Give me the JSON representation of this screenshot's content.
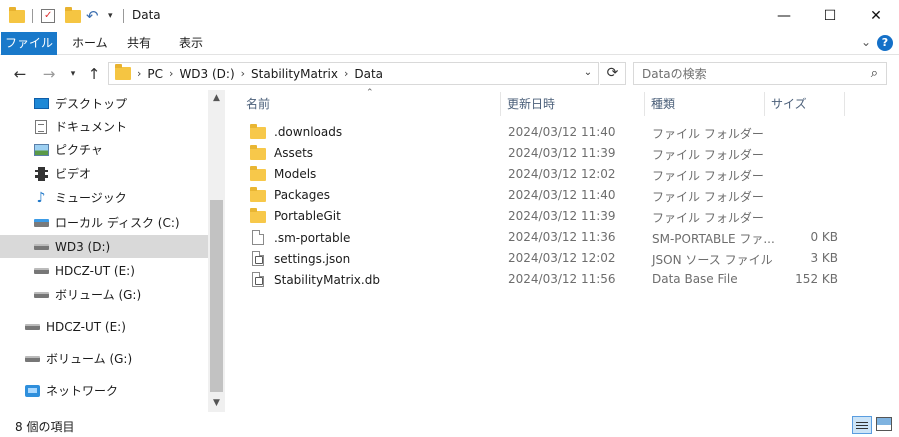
{
  "window": {
    "title": "Data",
    "controls": {
      "minimize": "—",
      "maximize": "☐",
      "close": "✕"
    }
  },
  "ribbon": {
    "tabs": [
      "ファイル",
      "ホーム",
      "共有",
      "表示"
    ],
    "help": "?"
  },
  "address": {
    "crumbs": [
      "PC",
      "WD3 (D:)",
      "StabilityMatrix",
      "Data"
    ],
    "separator": "›"
  },
  "search": {
    "placeholder": "Dataの検索"
  },
  "nav": {
    "items": [
      {
        "label": "デスクトップ",
        "icon": "desktop-icon"
      },
      {
        "label": "ドキュメント",
        "icon": "documents-icon"
      },
      {
        "label": "ピクチャ",
        "icon": "pictures-icon"
      },
      {
        "label": "ビデオ",
        "icon": "videos-icon"
      },
      {
        "label": "ミュージック",
        "icon": "music-icon"
      },
      {
        "label": "ローカル ディスク (C:)",
        "icon": "system-drive-icon"
      },
      {
        "label": "WD3 (D:)",
        "icon": "drive-icon",
        "selected": true
      },
      {
        "label": "HDCZ-UT (E:)",
        "icon": "drive-icon"
      },
      {
        "label": "ボリューム (G:)",
        "icon": "drive-icon"
      },
      {
        "label": "HDCZ-UT (E:)",
        "icon": "drive-icon"
      },
      {
        "label": "ボリューム (G:)",
        "icon": "drive-icon"
      },
      {
        "label": "ネットワーク",
        "icon": "network-icon"
      }
    ]
  },
  "columns": {
    "name": "名前",
    "date": "更新日時",
    "type": "種類",
    "size": "サイズ"
  },
  "files": [
    {
      "name": ".downloads",
      "date": "2024/03/12 11:40",
      "type": "ファイル フォルダー",
      "size": "",
      "kind": "folder"
    },
    {
      "name": "Assets",
      "date": "2024/03/12 11:39",
      "type": "ファイル フォルダー",
      "size": "",
      "kind": "folder"
    },
    {
      "name": "Models",
      "date": "2024/03/12 12:02",
      "type": "ファイル フォルダー",
      "size": "",
      "kind": "folder"
    },
    {
      "name": "Packages",
      "date": "2024/03/12 11:40",
      "type": "ファイル フォルダー",
      "size": "",
      "kind": "folder"
    },
    {
      "name": "PortableGit",
      "date": "2024/03/12 11:39",
      "type": "ファイル フォルダー",
      "size": "",
      "kind": "folder"
    },
    {
      "name": ".sm-portable",
      "date": "2024/03/12 11:36",
      "type": "SM-PORTABLE ファ...",
      "size": "0 KB",
      "kind": "file"
    },
    {
      "name": "settings.json",
      "date": "2024/03/12 12:02",
      "type": "JSON ソース ファイル",
      "size": "3 KB",
      "kind": "json"
    },
    {
      "name": "StabilityMatrix.db",
      "date": "2024/03/12 11:56",
      "type": "Data Base File",
      "size": "152 KB",
      "kind": "db"
    }
  ],
  "status": {
    "count": "8 個の項目"
  }
}
